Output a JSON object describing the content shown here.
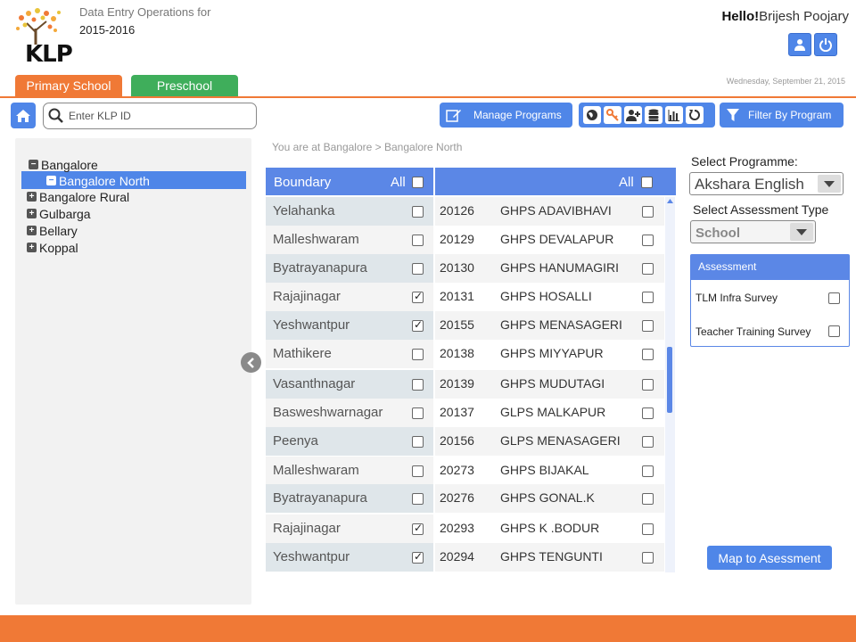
{
  "header": {
    "logo_text": "KLP",
    "subtitle": "Data Entry Operations for",
    "year": "2015-2016",
    "greeting_prefix": "Hello!",
    "user_name": "Brijesh Poojary",
    "date": "Wednesday, September 21, 2015"
  },
  "tabs": [
    {
      "label": "Primary School",
      "color": "#f07936"
    },
    {
      "label": "Preschool",
      "color": "#3fae5b"
    }
  ],
  "toolbar": {
    "search_placeholder": "Enter KLP ID",
    "manage_programs": "Manage Programs",
    "filter_by_program": "Filter By Program",
    "icons": [
      "globe-icon",
      "key-icon",
      "add-user-icon",
      "database-icon",
      "bar-chart-icon",
      "refresh-icon"
    ]
  },
  "tree": {
    "items": [
      {
        "label": "Bangalore",
        "expanded": true
      },
      {
        "label": "Bangalore North",
        "expanded": true,
        "selected": true
      },
      {
        "label": "Bangalore Rural"
      },
      {
        "label": "Gulbarga"
      },
      {
        "label": "Bellary"
      },
      {
        "label": "Koppal"
      }
    ]
  },
  "breadcrumb": "You are at Bangalore > Bangalore North",
  "boundary_table": {
    "header": "Boundary",
    "all_label": "All",
    "rows": [
      {
        "name": "Yelahanka",
        "checked": false
      },
      {
        "name": "Malleshwaram",
        "checked": false
      },
      {
        "name": "Byatrayanapura",
        "checked": false
      },
      {
        "name": "Rajajinagar",
        "checked": true
      },
      {
        "name": "Yeshwantpur",
        "checked": true
      },
      {
        "name": "Mathikere",
        "checked": false
      },
      {
        "name": "Vasanthnagar",
        "checked": false
      },
      {
        "name": "Basweshwarnagar",
        "checked": false
      },
      {
        "name": "Peenya",
        "checked": false
      },
      {
        "name": "Malleshwaram",
        "checked": false
      },
      {
        "name": "Byatrayanapura",
        "checked": false
      },
      {
        "name": "Rajajinagar",
        "checked": true
      },
      {
        "name": "Yeshwantpur",
        "checked": true
      }
    ]
  },
  "school_table": {
    "all_label": "All",
    "rows": [
      {
        "id": "20126",
        "name": "GHPS ADAVIBHAVI",
        "checked": false
      },
      {
        "id": "20129",
        "name": "GHPS DEVALAPUR",
        "checked": false
      },
      {
        "id": "20130",
        "name": "GHPS HANUMAGIRI",
        "checked": false
      },
      {
        "id": "20131",
        "name": "GHPS HOSALLI",
        "checked": false
      },
      {
        "id": "20155",
        "name": "GHPS MENASAGERI",
        "checked": false
      },
      {
        "id": "20138",
        "name": "GHPS MIYYAPUR",
        "checked": false
      },
      {
        "id": "20139",
        "name": "GHPS MUDUTAGI",
        "checked": false
      },
      {
        "id": "20137",
        "name": "GLPS MALKAPUR",
        "checked": false
      },
      {
        "id": "20156",
        "name": "GLPS MENASAGERI",
        "checked": false
      },
      {
        "id": "20273",
        "name": "GHPS BIJAKAL",
        "checked": false
      },
      {
        "id": "20276",
        "name": "GHPS GONAL.K",
        "checked": false
      },
      {
        "id": "20293",
        "name": "GHPS K .BODUR",
        "checked": false
      },
      {
        "id": "20294",
        "name": "GHPS TENGUNTI",
        "checked": false
      }
    ]
  },
  "right_panel": {
    "select_programme_label": "Select Programme:",
    "programme_value": "Akshara English",
    "select_assessment_type_label": "Select Assessment Type",
    "assessment_type_value": "School",
    "assessment_header": "Assessment",
    "assessments": [
      {
        "name": "TLM Infra Survey",
        "checked": false
      },
      {
        "name": "Teacher Training Survey",
        "checked": false
      }
    ],
    "map_button": "Map to Asessment"
  }
}
